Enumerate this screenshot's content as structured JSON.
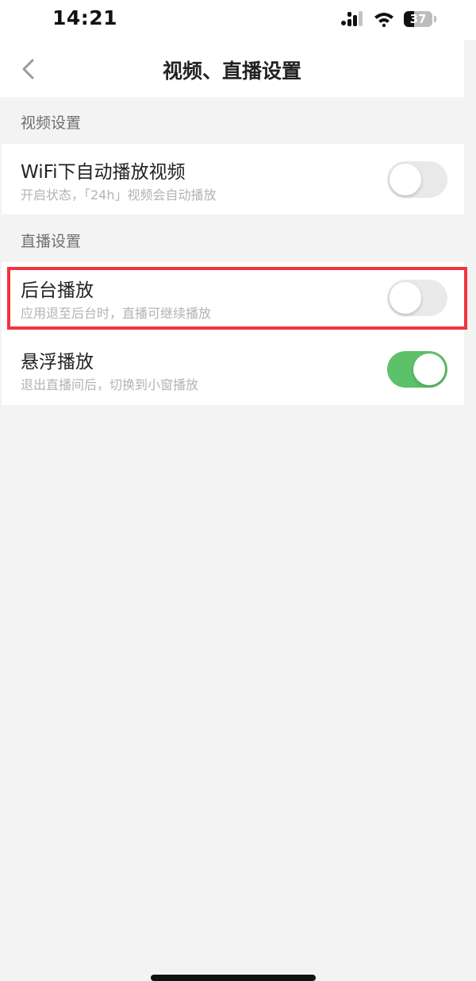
{
  "status_bar": {
    "time": "14:21",
    "battery_level": "37",
    "icons": [
      "signal-icon",
      "wifi-icon",
      "battery-icon"
    ]
  },
  "nav": {
    "title": "视频、直播设置",
    "back_icon": "chevron-left-icon"
  },
  "sections": {
    "video": {
      "header": "视频设置",
      "items": [
        {
          "title": "WiFi下自动播放视频",
          "subtitle": "开启状态，「24h」视频会自动播放",
          "enabled": false
        }
      ]
    },
    "live": {
      "header": "直播设置",
      "items": [
        {
          "title": "后台播放",
          "subtitle": "应用退至后台时，直播可继续播放",
          "enabled": false
        },
        {
          "title": "悬浮播放",
          "subtitle": "退出直播间后，切换到小窗播放",
          "enabled": true
        }
      ]
    }
  },
  "colors": {
    "toggle_on": "#5cc168",
    "toggle_off": "#e9e9e9",
    "highlight": "#f0353c",
    "background": "#f3f3f3"
  }
}
